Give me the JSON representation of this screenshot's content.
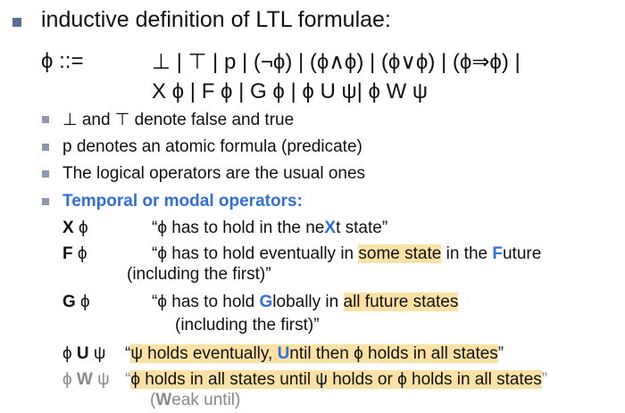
{
  "heading": "inductive definition of LTL formulae:",
  "grammar": {
    "lhs": "ϕ ::=",
    "line1": "⊥ | ⊤ | p | (¬ϕ) | (ϕ∧ϕ) | (ϕ∨ϕ) | (ϕ⇒ϕ) |",
    "line2": "X ϕ | F ϕ | G ϕ | ϕ U ψ| ϕ W ψ"
  },
  "notes": [
    "⊥ and ⊤ denote false and true",
    "p denotes an atomic formula (predicate)",
    "The logical operators are the usual ones",
    "Temporal or modal operators:"
  ],
  "operators": {
    "X": {
      "symbol_bold": "X",
      "symbol_rest": " ϕ",
      "desc_a": "“ϕ has to hold in the ne",
      "desc_letter": "X",
      "desc_b": "t state”"
    },
    "F": {
      "symbol_bold": "F",
      "symbol_rest": " ϕ",
      "desc_a": "“ϕ has to hold eventually in ",
      "desc_hl": "some state",
      "desc_b": " in the ",
      "desc_letter": "F",
      "desc_c": "uture",
      "desc_line2": "(including the first)”"
    },
    "G": {
      "symbol_bold": "G",
      "symbol_rest": " ϕ",
      "desc_a": "“ϕ has to hold ",
      "desc_letter": "G",
      "desc_b": "lobally in ",
      "desc_hl": "all future states",
      "desc_line2": "(including the first)”"
    },
    "U": {
      "symbol_a": "ϕ ",
      "symbol_bold": "U",
      "symbol_b": " ψ",
      "desc_q": "“",
      "desc_a": "ψ holds eventually, ",
      "desc_letter": "U",
      "desc_b": "ntil then ϕ holds in all states",
      "desc_end": "”"
    },
    "W": {
      "symbol_a": "ϕ ",
      "symbol_bold": "W",
      "symbol_b": " ψ",
      "desc_q": "“",
      "desc_hl": "ϕ holds in all states until ψ holds or ϕ holds in all states",
      "desc_end": "”",
      "note_a": "(",
      "note_bold": "W",
      "note_b": "eak until)"
    }
  },
  "colors": {
    "accent_blue": "#2f6fe0",
    "highlight": "#fbe2a4",
    "muted_gray": "#8a8a8a"
  }
}
